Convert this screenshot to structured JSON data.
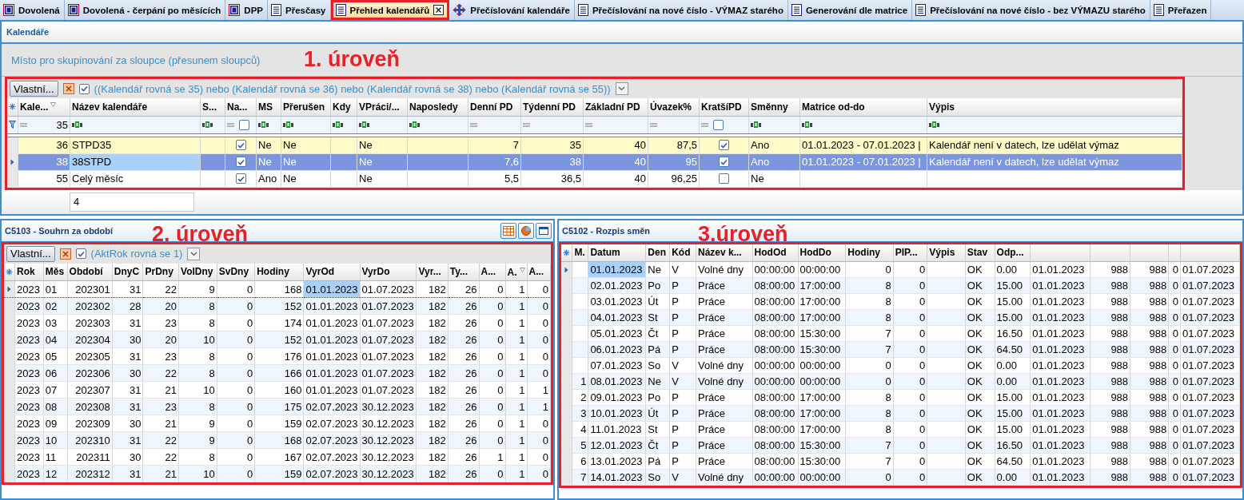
{
  "tabs": [
    {
      "label": "Dovolená",
      "kind": "form",
      "selected": false,
      "highlighted": false
    },
    {
      "label": "Dovolená - čerpání po měsících",
      "kind": "form",
      "selected": false,
      "highlighted": false
    },
    {
      "label": "DPP",
      "kind": "form",
      "selected": false,
      "highlighted": false
    },
    {
      "label": "Přesčasy",
      "kind": "document",
      "selected": false,
      "highlighted": false
    },
    {
      "label": "Přehled kalendářů",
      "kind": "document",
      "selected": true,
      "highlighted": true
    },
    {
      "label": "Přečíslování kalendáře",
      "kind": "move",
      "selected": false,
      "highlighted": false
    },
    {
      "label": "Přečíslování na nové číslo - VÝMAZ starého",
      "kind": "document",
      "selected": false,
      "highlighted": false
    },
    {
      "label": "Generování dle matrice",
      "kind": "document",
      "selected": false,
      "highlighted": false
    },
    {
      "label": "Přečíslování na nové číslo - bez VÝMAZU starého",
      "kind": "document",
      "selected": false,
      "highlighted": false
    },
    {
      "label": "Přeřazen",
      "kind": "document",
      "selected": false,
      "highlighted": false
    }
  ],
  "window_title": "Kalendáře",
  "group_panel": {
    "hint": "Místo pro skupinování za sloupce (přesunem sloupců)",
    "annotation": "1. úroveň"
  },
  "main_grid": {
    "filter_bar": {
      "button": "Vlastní...",
      "enabled": true,
      "expression": "((Kalendář rovná se 35) nebo (Kalendář rovná se 36) nebo (Kalendář rovná se 38) nebo (Kalendář rovná se 55))"
    },
    "columns": [
      {
        "label": "Kale...",
        "filtered": true
      },
      {
        "label": "Název kalendáře",
        "filtered": false
      },
      {
        "label": "S...",
        "filtered": false
      },
      {
        "label": "Na...",
        "filtered": false
      },
      {
        "label": "MS",
        "filtered": false
      },
      {
        "label": "Přerušen",
        "filtered": false
      },
      {
        "label": "Kdy",
        "filtered": false
      },
      {
        "label": "VPráci/...",
        "filtered": false
      },
      {
        "label": "Naposledy",
        "filtered": false
      },
      {
        "label": "Denní PD",
        "filtered": false
      },
      {
        "label": "Týdenní PD",
        "filtered": false
      },
      {
        "label": "Základní PD",
        "filtered": false
      },
      {
        "label": "Úvazek%",
        "filtered": false
      },
      {
        "label": "KratšíPD",
        "filtered": false
      },
      {
        "label": "Směnny",
        "filtered": false
      },
      {
        "label": "Matrice od-do",
        "filtered": false
      },
      {
        "label": "Výpis",
        "filtered": false
      }
    ],
    "filter_row": [
      {
        "kind": "equals",
        "value": "35"
      },
      {
        "kind": "text"
      },
      {
        "kind": "text"
      },
      {
        "kind": "check",
        "checked": false
      },
      {
        "kind": "text"
      },
      {
        "kind": "text"
      },
      {
        "kind": "text"
      },
      {
        "kind": "text"
      },
      {
        "kind": "text"
      },
      {
        "kind": "equals"
      },
      {
        "kind": "equals"
      },
      {
        "kind": "equals"
      },
      {
        "kind": "equals"
      },
      {
        "kind": "check",
        "checked": false
      },
      {
        "kind": "text"
      },
      {
        "kind": "text"
      },
      {
        "kind": "text"
      }
    ],
    "rows": [
      {
        "current": false,
        "selected": false,
        "highlighted": true,
        "cells": [
          "36",
          "STPD35",
          null,
          {
            "checked": true
          },
          "Ne",
          "Ne",
          null,
          "Ne",
          null,
          "7",
          "35",
          "40",
          "87,5",
          {
            "checked": true
          },
          "Ano",
          "01.01.2023 - 07.01.2023 |",
          "Kalendář není v datech, lze udělat výmaz"
        ]
      },
      {
        "current": true,
        "selected": true,
        "highlighted": false,
        "cells": [
          "38",
          {
            "text": "38STPD",
            "focused": true
          },
          null,
          {
            "checked": true
          },
          "Ne",
          "Ne",
          null,
          "Ne",
          null,
          "7,6",
          "38",
          "40",
          "95",
          {
            "checked": true
          },
          "Ano",
          "01.01.2023 - 07.01.2023 |",
          "Kalendář není v datech, lze udělat výmaz"
        ]
      },
      {
        "current": false,
        "selected": false,
        "highlighted": false,
        "cells": [
          "55",
          "Celý měsíc",
          null,
          {
            "checked": true
          },
          "Ano",
          "Ne",
          null,
          "Ne",
          null,
          "5,5",
          "36,5",
          "40",
          "96,25",
          {
            "checked": false
          },
          "Ne",
          null,
          null
        ]
      }
    ],
    "summary": "4"
  },
  "summary_panel": {
    "title": "C5103 - Souhrn za období",
    "annotation": "2. úroveň",
    "filter_bar": {
      "button": "Vlastní...",
      "enabled": true,
      "expression": "(AktRok rovná se 1)"
    },
    "columns": [
      {
        "label": "Rok",
        "filtered": false
      },
      {
        "label": "Měs",
        "filtered": false
      },
      {
        "label": "Období",
        "filtered": false
      },
      {
        "label": "DnyC",
        "filtered": false
      },
      {
        "label": "PrDny",
        "filtered": false
      },
      {
        "label": "VolDny",
        "filtered": false
      },
      {
        "label": "SvDny",
        "filtered": false
      },
      {
        "label": "Hodiny",
        "filtered": false
      },
      {
        "label": "VyrOd",
        "filtered": false
      },
      {
        "label": "VyrDo",
        "filtered": false
      },
      {
        "label": "Vyr...",
        "filtered": false
      },
      {
        "label": "Ty...",
        "filtered": false
      },
      {
        "label": "A...",
        "filtered": false
      },
      {
        "label": "A.",
        "filtered": true
      },
      {
        "label": "A...",
        "filtered": false
      }
    ],
    "rows": [
      {
        "current": true,
        "cells": [
          "2023",
          "01",
          "202301",
          "31",
          "22",
          "9",
          "0",
          "168",
          {
            "text": "01.01.2023",
            "focused": true
          },
          "01.07.2023",
          "182",
          "26",
          "0",
          "1",
          "0"
        ]
      },
      {
        "current": false,
        "cells": [
          "2023",
          "02",
          "202302",
          "28",
          "20",
          "8",
          "0",
          "152",
          "01.01.2023",
          "01.07.2023",
          "182",
          "26",
          "0",
          "1",
          "0"
        ]
      },
      {
        "current": false,
        "cells": [
          "2023",
          "03",
          "202303",
          "31",
          "23",
          "8",
          "0",
          "174",
          "01.01.2023",
          "01.07.2023",
          "182",
          "26",
          "0",
          "1",
          "0"
        ]
      },
      {
        "current": false,
        "cells": [
          "2023",
          "04",
          "202304",
          "30",
          "20",
          "10",
          "0",
          "152",
          "01.01.2023",
          "01.07.2023",
          "182",
          "26",
          "0",
          "1",
          "0"
        ]
      },
      {
        "current": false,
        "cells": [
          "2023",
          "05",
          "202305",
          "31",
          "23",
          "8",
          "0",
          "176",
          "01.01.2023",
          "01.07.2023",
          "182",
          "26",
          "0",
          "1",
          "0"
        ]
      },
      {
        "current": false,
        "cells": [
          "2023",
          "06",
          "202306",
          "30",
          "22",
          "8",
          "0",
          "166",
          "01.01.2023",
          "01.07.2023",
          "182",
          "26",
          "0",
          "1",
          "0"
        ]
      },
      {
        "current": false,
        "cells": [
          "2023",
          "07",
          "202307",
          "31",
          "21",
          "10",
          "0",
          "160",
          "01.01.2023",
          "01.07.2023",
          "182",
          "26",
          "0",
          "1",
          "1"
        ]
      },
      {
        "current": false,
        "cells": [
          "2023",
          "08",
          "202308",
          "31",
          "23",
          "8",
          "0",
          "175",
          "02.07.2023",
          "30.12.2023",
          "182",
          "26",
          "0",
          "1",
          "1"
        ]
      },
      {
        "current": false,
        "cells": [
          "2023",
          "09",
          "202309",
          "30",
          "21",
          "9",
          "0",
          "159",
          "02.07.2023",
          "30.12.2023",
          "182",
          "26",
          "0",
          "1",
          "0"
        ]
      },
      {
        "current": false,
        "cells": [
          "2023",
          "10",
          "202310",
          "31",
          "22",
          "9",
          "0",
          "168",
          "02.07.2023",
          "30.12.2023",
          "182",
          "26",
          "0",
          "1",
          "0"
        ]
      },
      {
        "current": false,
        "cells": [
          "2023",
          "11",
          "202311",
          "30",
          "22",
          "8",
          "0",
          "167",
          "02.07.2023",
          "30.12.2023",
          "182",
          "26",
          "1",
          "1",
          "0"
        ]
      },
      {
        "current": false,
        "cells": [
          "2023",
          "12",
          "202312",
          "31",
          "21",
          "10",
          "0",
          "159",
          "02.07.2023",
          "30.12.2023",
          "182",
          "26",
          "0",
          "1",
          "0"
        ]
      }
    ]
  },
  "shift_panel": {
    "title": "C5102 - Rozpis směn",
    "annotation": "3.úroveň",
    "columns": [
      "M.",
      "Datum",
      "Den",
      "Kód",
      "Název k...",
      "HodOd",
      "HodDo",
      "Hodiny",
      "PIP...",
      "Výpis",
      "Stav",
      "Odp..."
    ],
    "rows": [
      {
        "current": true,
        "cells": [
          null,
          {
            "text": "01.01.2023",
            "focused": true
          },
          "Ne",
          "V",
          "Volné dny",
          "00:00:00",
          "00:00:00",
          "0",
          "0",
          null,
          "OK",
          "0.00",
          "01.01.2023",
          "988",
          "988",
          "0",
          "01.07.2023"
        ]
      },
      {
        "current": false,
        "cells": [
          null,
          "02.01.2023",
          "Po",
          "P",
          "Práce",
          "08:00:00",
          "17:00:00",
          "8",
          "0",
          null,
          "OK",
          "15.00",
          "01.01.2023",
          "988",
          "988",
          "0",
          "01.07.2023"
        ]
      },
      {
        "current": false,
        "cells": [
          null,
          "03.01.2023",
          "Út",
          "P",
          "Práce",
          "08:00:00",
          "17:00:00",
          "8",
          "0",
          null,
          "OK",
          "15.00",
          "01.01.2023",
          "988",
          "988",
          "0",
          "01.07.2023"
        ]
      },
      {
        "current": false,
        "cells": [
          null,
          "04.01.2023",
          "St",
          "P",
          "Práce",
          "08:00:00",
          "17:00:00",
          "8",
          "0",
          null,
          "OK",
          "15.00",
          "01.01.2023",
          "988",
          "988",
          "0",
          "01.07.2023"
        ]
      },
      {
        "current": false,
        "cells": [
          null,
          "05.01.2023",
          "Čt",
          "P",
          "Práce",
          "08:00:00",
          "15:30:00",
          "7",
          "0",
          null,
          "OK",
          "16.50",
          "01.01.2023",
          "988",
          "988",
          "0",
          "01.07.2023"
        ]
      },
      {
        "current": false,
        "cells": [
          null,
          "06.01.2023",
          "Pá",
          "P",
          "Práce",
          "08:00:00",
          "15:30:00",
          "7",
          "0",
          null,
          "OK",
          "64.50",
          "01.01.2023",
          "988",
          "988",
          "0",
          "01.07.2023"
        ]
      },
      {
        "current": false,
        "cells": [
          null,
          "07.01.2023",
          "So",
          "V",
          "Volné dny",
          "00:00:00",
          "00:00:00",
          "0",
          "0",
          null,
          "OK",
          "0.00",
          "01.01.2023",
          "988",
          "988",
          "0",
          "01.07.2023"
        ]
      },
      {
        "current": false,
        "cells": [
          "1",
          "08.01.2023",
          "Ne",
          "V",
          "Volné dny",
          "00:00:00",
          "00:00:00",
          "0",
          "0",
          null,
          "OK",
          "0.00",
          "01.01.2023",
          "988",
          "988",
          "0",
          "01.07.2023"
        ]
      },
      {
        "current": false,
        "cells": [
          "2",
          "09.01.2023",
          "Po",
          "P",
          "Práce",
          "08:00:00",
          "17:00:00",
          "8",
          "0",
          null,
          "OK",
          "15.00",
          "01.01.2023",
          "988",
          "988",
          "0",
          "01.07.2023"
        ]
      },
      {
        "current": false,
        "cells": [
          "3",
          "10.01.2023",
          "Út",
          "P",
          "Práce",
          "08:00:00",
          "17:00:00",
          "8",
          "0",
          null,
          "OK",
          "15.00",
          "01.01.2023",
          "988",
          "988",
          "0",
          "01.07.2023"
        ]
      },
      {
        "current": false,
        "cells": [
          "4",
          "11.01.2023",
          "St",
          "P",
          "Práce",
          "08:00:00",
          "17:00:00",
          "8",
          "0",
          null,
          "OK",
          "15.00",
          "01.01.2023",
          "988",
          "988",
          "0",
          "01.07.2023"
        ]
      },
      {
        "current": false,
        "cells": [
          "5",
          "12.01.2023",
          "Čt",
          "P",
          "Práce",
          "08:00:00",
          "15:30:00",
          "7",
          "0",
          null,
          "OK",
          "16.50",
          "01.01.2023",
          "988",
          "988",
          "0",
          "01.07.2023"
        ]
      },
      {
        "current": false,
        "cells": [
          "6",
          "13.01.2023",
          "Pá",
          "P",
          "Práce",
          "08:00:00",
          "15:30:00",
          "7",
          "0",
          null,
          "OK",
          "64.50",
          "01.01.2023",
          "988",
          "988",
          "0",
          "01.07.2023"
        ]
      },
      {
        "current": false,
        "cells": [
          "7",
          "14.01.2023",
          "So",
          "V",
          "Volné dny",
          "00:00:00",
          "00:00:00",
          "0",
          "0",
          null,
          "OK",
          "0.00",
          "01.01.2023",
          "988",
          "988",
          "0",
          "01.07.2023"
        ]
      }
    ]
  }
}
